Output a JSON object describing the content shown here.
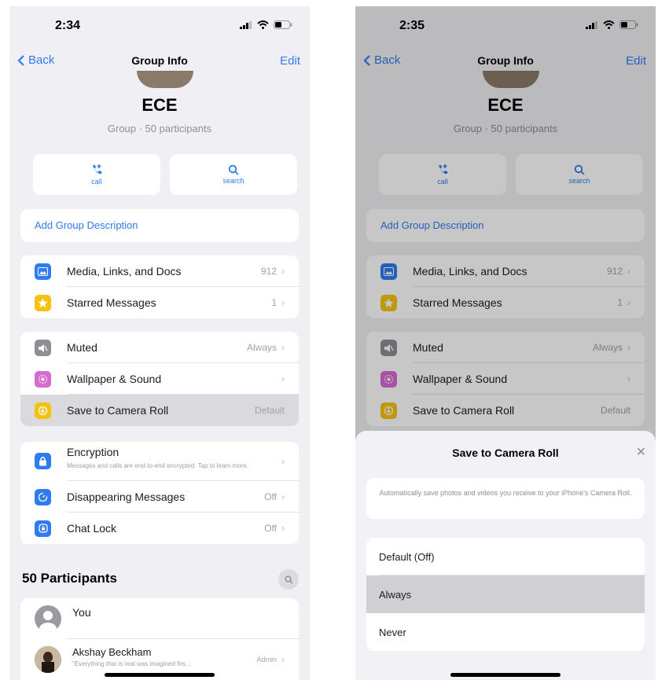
{
  "left": {
    "status_time": "2:34",
    "nav": {
      "back": "Back",
      "title": "Group Info",
      "edit": "Edit"
    },
    "group": {
      "name": "ECE",
      "subtitle": "Group · 50 participants"
    },
    "actions": [
      {
        "icon": "phone-plus-icon",
        "label": "call"
      },
      {
        "icon": "search-icon",
        "label": "search"
      }
    ],
    "add_description": "Add Group Description",
    "media_rows": [
      {
        "icon": "photo-icon",
        "label": "Media, Links, and Docs",
        "value": "912",
        "color": "#2f7bf0"
      },
      {
        "icon": "star-icon",
        "label": "Starred Messages",
        "value": "1",
        "color": "#f4c311"
      }
    ],
    "settings_rows": [
      {
        "icon": "speaker-muted-icon",
        "label": "Muted",
        "value": "Always",
        "color": "#8e8e93"
      },
      {
        "icon": "flower-icon",
        "label": "Wallpaper & Sound",
        "value": "",
        "color": "#d56bd1"
      },
      {
        "icon": "download-icon",
        "label": "Save to Camera Roll",
        "value": "Default",
        "color": "#f4c311"
      }
    ],
    "privacy_rows": [
      {
        "icon": "lock-icon",
        "label": "Encryption",
        "sub": "Messages and calls are end-to-end encrypted. Tap to learn more.",
        "color": "#2f7bf0"
      },
      {
        "icon": "timer-icon",
        "label": "Disappearing Messages",
        "value": "Off",
        "color": "#2f7bf0"
      },
      {
        "icon": "chat-lock-icon",
        "label": "Chat Lock",
        "value": "Off",
        "color": "#2f7bf0"
      }
    ],
    "participants_title": "50 Participants",
    "participants": [
      {
        "name": "You",
        "sub": "",
        "badge": ""
      },
      {
        "name": "Akshay Beckham",
        "sub": "\"Everything that is real was imagined firs...",
        "badge": "Admin"
      }
    ]
  },
  "right": {
    "status_time": "2:35",
    "sheet": {
      "title": "Save to Camera Roll",
      "description": "Automatically save photos and videos you receive to your iPhone's Camera Roll.",
      "options": [
        "Default (Off)",
        "Always",
        "Never"
      ],
      "selected": "Always"
    }
  }
}
